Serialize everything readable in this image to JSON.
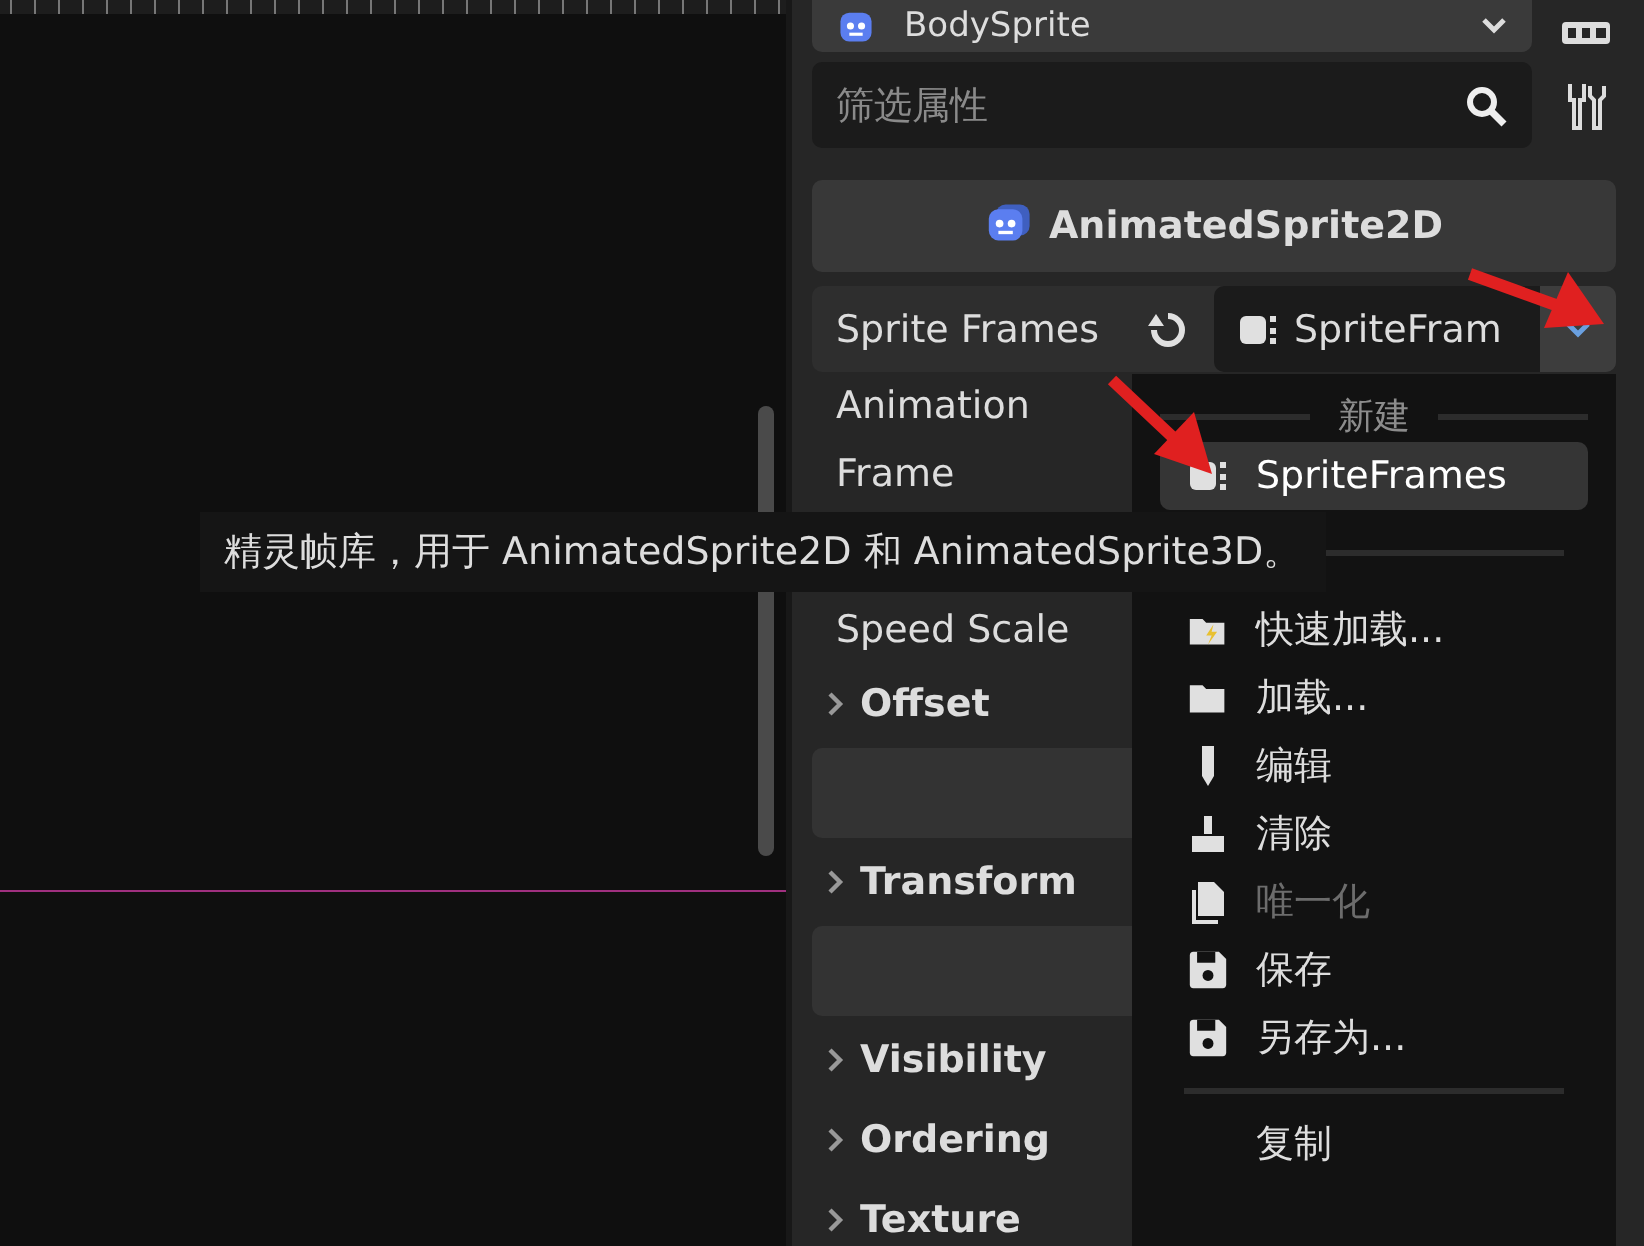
{
  "viewport": {
    "tooltip": "精灵帧库，用于 AnimatedSprite2D 和 AnimatedSprite3D。"
  },
  "inspector": {
    "node_selector": {
      "label": "BodySprite"
    },
    "filter": {
      "placeholder": "筛选属性"
    },
    "class_header": {
      "label": "AnimatedSprite2D"
    },
    "properties": [
      {
        "kind": "resource",
        "label": "Sprite Frames",
        "value": "SpriteFram"
      },
      {
        "kind": "plain",
        "label": "Animation"
      },
      {
        "kind": "plain",
        "label": "Frame"
      },
      {
        "kind": "plain",
        "label": "Speed Scale"
      },
      {
        "kind": "section",
        "label": "Offset",
        "expanded": false
      },
      {
        "kind": "cyclebar"
      },
      {
        "kind": "section",
        "label": "Transform",
        "expanded": false
      },
      {
        "kind": "brushbar"
      },
      {
        "kind": "section",
        "label": "Visibility",
        "expanded": false
      },
      {
        "kind": "section",
        "label": "Ordering",
        "expanded": false
      },
      {
        "kind": "section",
        "label": "Texture",
        "expanded": false
      }
    ]
  },
  "menu": {
    "header": "新建",
    "items": [
      {
        "kind": "sprite",
        "label": "SpriteFrames",
        "selected": true,
        "disabled": false
      },
      {
        "kind": "separator"
      },
      {
        "kind": "quickload",
        "label": "快速加载...",
        "selected": false,
        "disabled": false
      },
      {
        "kind": "load",
        "label": "加载...",
        "selected": false,
        "disabled": false
      },
      {
        "kind": "edit",
        "label": "编辑",
        "selected": false,
        "disabled": false
      },
      {
        "kind": "clear",
        "label": "清除",
        "selected": false,
        "disabled": false
      },
      {
        "kind": "unique",
        "label": "唯一化",
        "selected": false,
        "disabled": true
      },
      {
        "kind": "save",
        "label": "保存",
        "selected": false,
        "disabled": false
      },
      {
        "kind": "saveas",
        "label": "另存为...",
        "selected": false,
        "disabled": false
      },
      {
        "kind": "separator"
      },
      {
        "kind": "copy",
        "label": "复制",
        "selected": false,
        "disabled": false
      }
    ]
  }
}
